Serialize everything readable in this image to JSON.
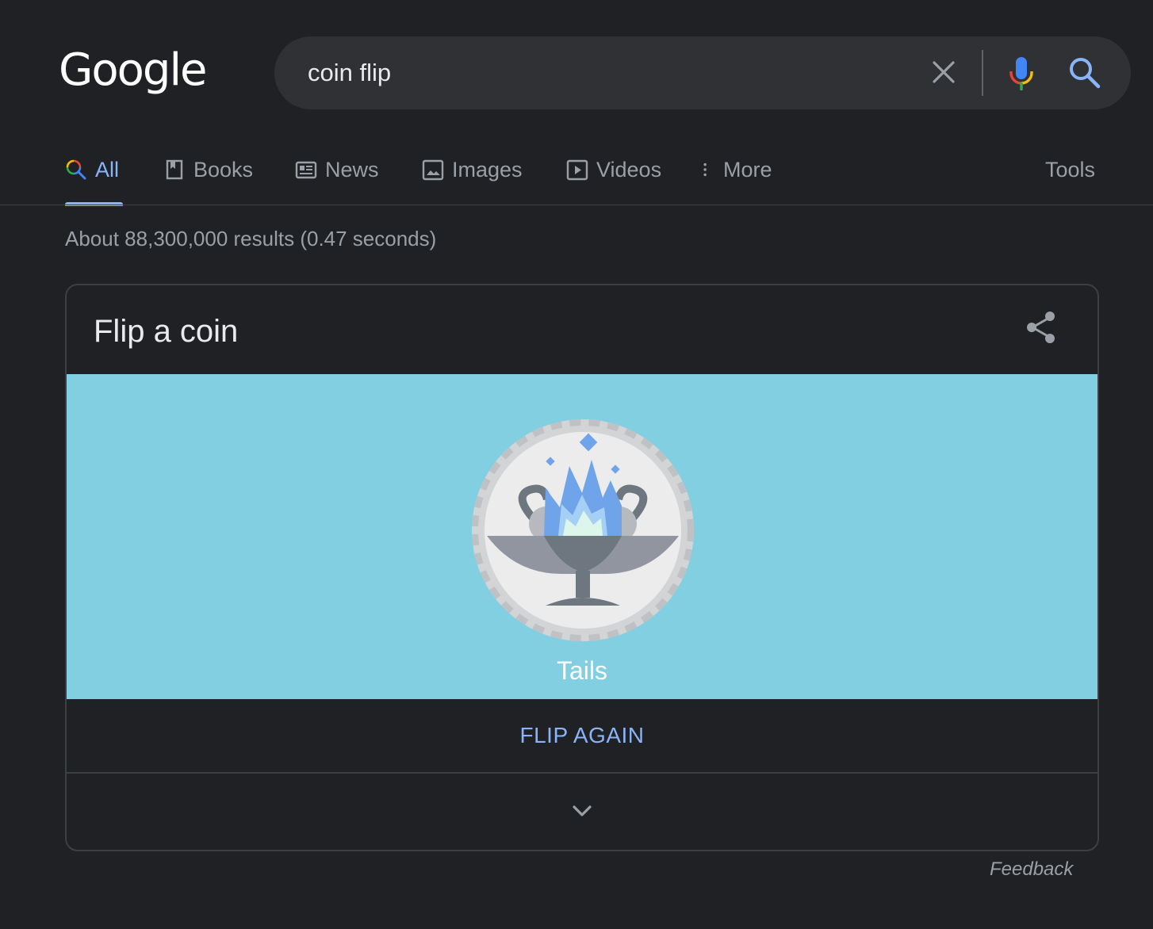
{
  "header": {
    "logo_text": "Google",
    "search": {
      "value": "coin flip",
      "placeholder": "",
      "clear_icon": "close-icon",
      "mic_icon": "mic-icon",
      "search_icon": "search-icon"
    }
  },
  "tabs": [
    {
      "label": "All",
      "icon": "search-icon",
      "active": true
    },
    {
      "label": "Books",
      "icon": "book-icon",
      "active": false
    },
    {
      "label": "News",
      "icon": "news-icon",
      "active": false
    },
    {
      "label": "Images",
      "icon": "image-icon",
      "active": false
    },
    {
      "label": "Videos",
      "icon": "video-icon",
      "active": false
    },
    {
      "label": "More",
      "icon": "more-vert-icon",
      "active": false
    }
  ],
  "tools_label": "Tools",
  "results_stats": "About 88,300,000 results (0.47 seconds)",
  "card": {
    "title": "Flip a coin",
    "share_icon": "share-icon",
    "result": "Tails",
    "flip_again_label": "FLIP AGAIN",
    "expand_icon": "chevron-down-icon"
  },
  "feedback_label": "Feedback",
  "colors": {
    "background": "#202124",
    "search_box": "#303134",
    "accent": "#8ab4f8",
    "coin_panel": "#81cfe0",
    "muted_text": "#9aa0a6"
  }
}
